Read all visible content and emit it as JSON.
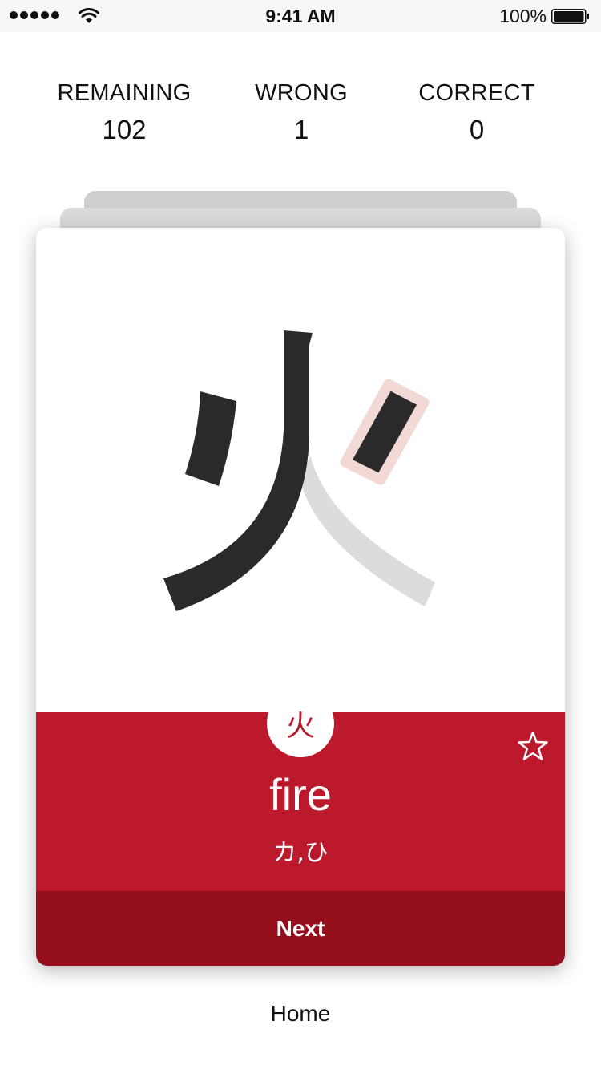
{
  "status_bar": {
    "time": "9:41 AM",
    "battery_percent": "100%",
    "signal_bars": 5,
    "icons": [
      "signal-dots-icon",
      "wifi-icon",
      "battery-icon"
    ]
  },
  "stats": {
    "remaining": {
      "label": "REMAINING",
      "value": "102"
    },
    "wrong": {
      "label": "WRONG",
      "value": "1"
    },
    "correct": {
      "label": "CORRECT",
      "value": "0"
    }
  },
  "card": {
    "kanji": "火",
    "meaning": "fire",
    "reading": "カ,ひ",
    "favorite_icon": "star-outline-icon",
    "next_label": "Next"
  },
  "footer": {
    "home_label": "Home"
  },
  "colors": {
    "accent": "#bc1a2c",
    "accent_dark": "#940e1c",
    "stroke_done": "#2a2a2a",
    "stroke_pending": "#dcdcdc",
    "stroke_hint": "#f2d9d6"
  }
}
